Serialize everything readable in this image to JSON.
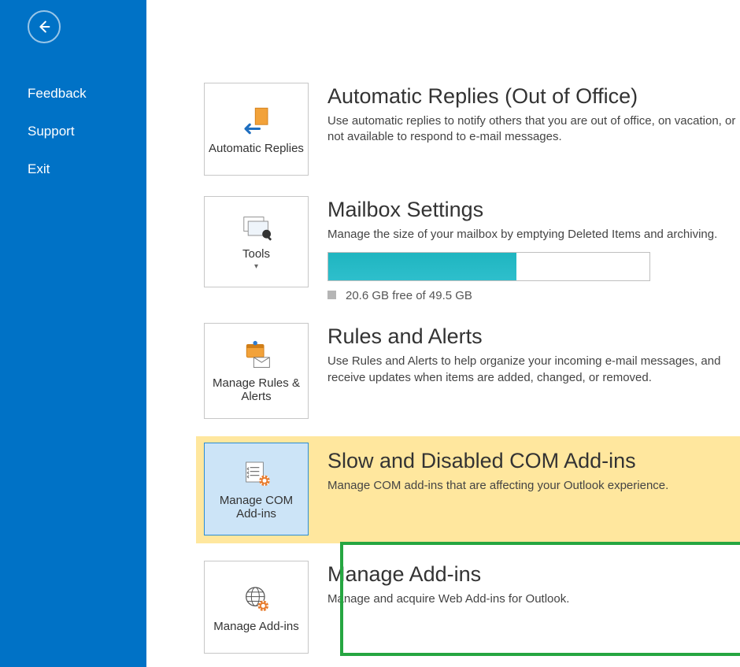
{
  "sidebar": {
    "items": [
      {
        "label": "Feedback"
      },
      {
        "label": "Support"
      },
      {
        "label": "Exit"
      }
    ]
  },
  "tiles": {
    "auto_replies": "Automatic Replies",
    "tools": "Tools",
    "manage_rules": "Manage Rules & Alerts",
    "manage_com": "Manage COM Add-ins",
    "manage_addins": "Manage Add-ins"
  },
  "sections": {
    "auto": {
      "title": "Automatic Replies (Out of Office)",
      "desc": "Use automatic replies to notify others that you are out of office, on vacation, or not available to respond to e-mail messages."
    },
    "mailbox": {
      "title": "Mailbox Settings",
      "desc": "Manage the size of your mailbox by emptying Deleted Items and archiving.",
      "storage_text": "20.6 GB free of 49.5 GB",
      "used_fraction": 0.585
    },
    "rules": {
      "title": "Rules and Alerts",
      "desc": "Use Rules and Alerts to help organize your incoming e-mail messages, and receive updates when items are added, changed, or removed."
    },
    "com": {
      "title": "Slow and Disabled COM Add-ins",
      "desc": "Manage COM add-ins that are affecting your Outlook experience."
    },
    "addins": {
      "title": "Manage Add-ins",
      "desc": "Manage and acquire Web Add-ins for Outlook."
    }
  },
  "colors": {
    "brand": "#0072C6",
    "highlight_bg": "#ffe79e",
    "annotation_border": "#26a641",
    "storage_fill": "#27bac6"
  }
}
